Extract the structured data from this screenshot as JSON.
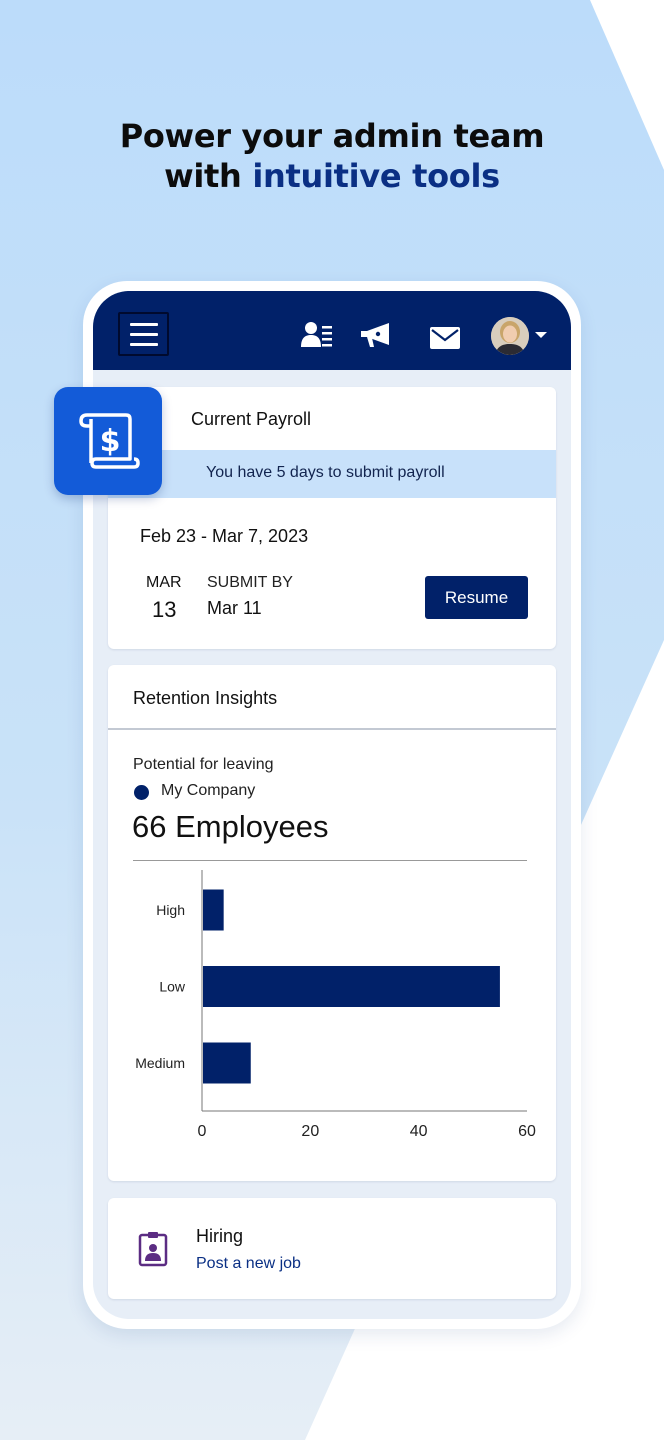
{
  "headline": {
    "line1": "Power your admin team",
    "line2_prefix": "with",
    "line2_accent": "intuitive tools"
  },
  "colors": {
    "navy": "#012169",
    "accent_blue": "#135bd8",
    "banner": "#c8e1fa",
    "hiring_icon": "#5b2c83"
  },
  "appbar": {
    "icons": [
      "menu-icon",
      "directory-icon",
      "megaphone-icon",
      "mail-icon",
      "avatar",
      "chevron-down-icon"
    ]
  },
  "payroll": {
    "icon": "payroll-scroll-dollar-icon",
    "title": "Current Payroll",
    "banner": "You have 5 days to submit payroll",
    "range": "Feb 23 - Mar 7, 2023",
    "month": "MAR",
    "day": "13",
    "submit_label": "SUBMIT BY",
    "submit_date": "Mar 11",
    "resume_label": "Resume"
  },
  "retention": {
    "title": "Retention Insights",
    "potential_label": "Potential for leaving",
    "legend_label": "My Company",
    "count": "66 Employees"
  },
  "chart_data": {
    "type": "bar",
    "orientation": "horizontal",
    "categories": [
      "High",
      "Low",
      "Medium"
    ],
    "series": [
      {
        "name": "My Company",
        "values": [
          4,
          55,
          9
        ]
      }
    ],
    "xlim": [
      0,
      60
    ],
    "xticks": [
      "0",
      "20",
      "40",
      "60"
    ],
    "grid": false
  },
  "hiring": {
    "icon": "id-badge-icon",
    "title": "Hiring",
    "link": "Post a new job"
  }
}
